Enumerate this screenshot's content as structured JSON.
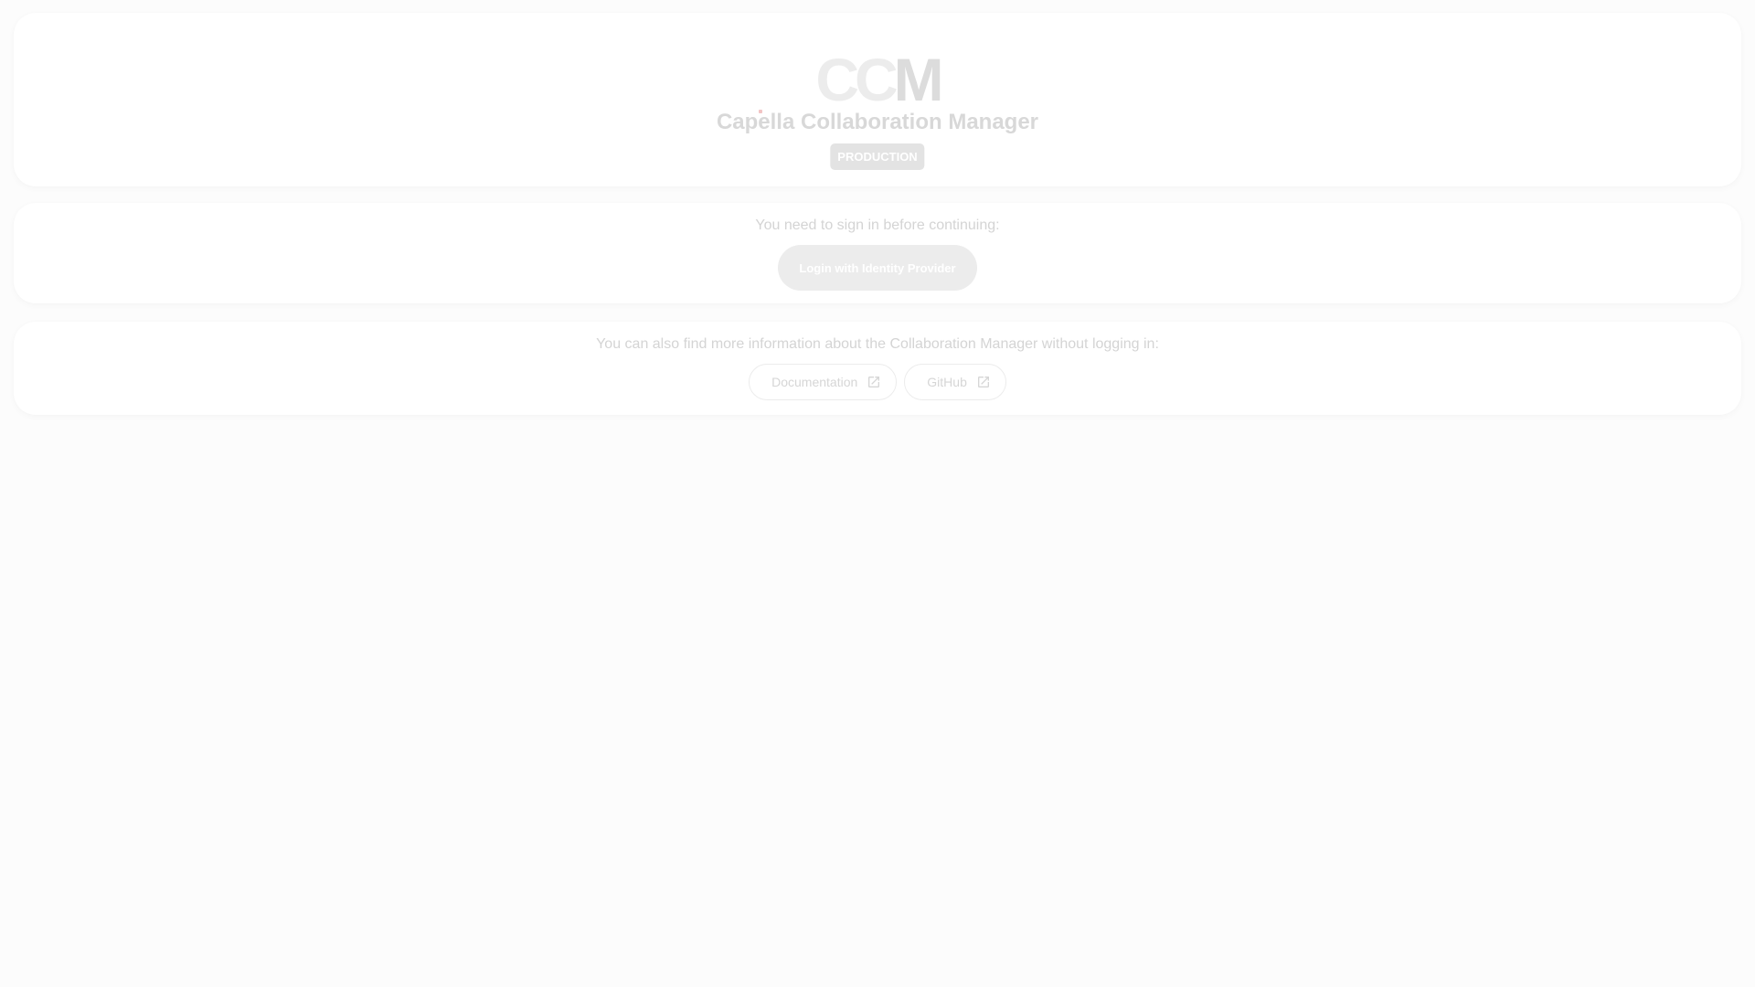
{
  "header": {
    "logo_c1": "C",
    "logo_c2": "C",
    "logo_m": "M",
    "app_title": "Capella Collaboration Manager",
    "environment_badge": "PRODUCTION"
  },
  "login": {
    "prompt": "You need to sign in before continuing:",
    "button_label": "Login with Identity Provider"
  },
  "info": {
    "text": "You can also find more information about the Collaboration Manager without logging in:",
    "links": [
      {
        "label": "Documentation",
        "icon": "open-in-new-icon"
      },
      {
        "label": "GitHub",
        "icon": "open-in-new-icon"
      }
    ]
  },
  "colors": {
    "background": "#fcfcfc",
    "card": "#ffffff",
    "badge": "#e3e3e3",
    "login_button": "#ececec"
  }
}
